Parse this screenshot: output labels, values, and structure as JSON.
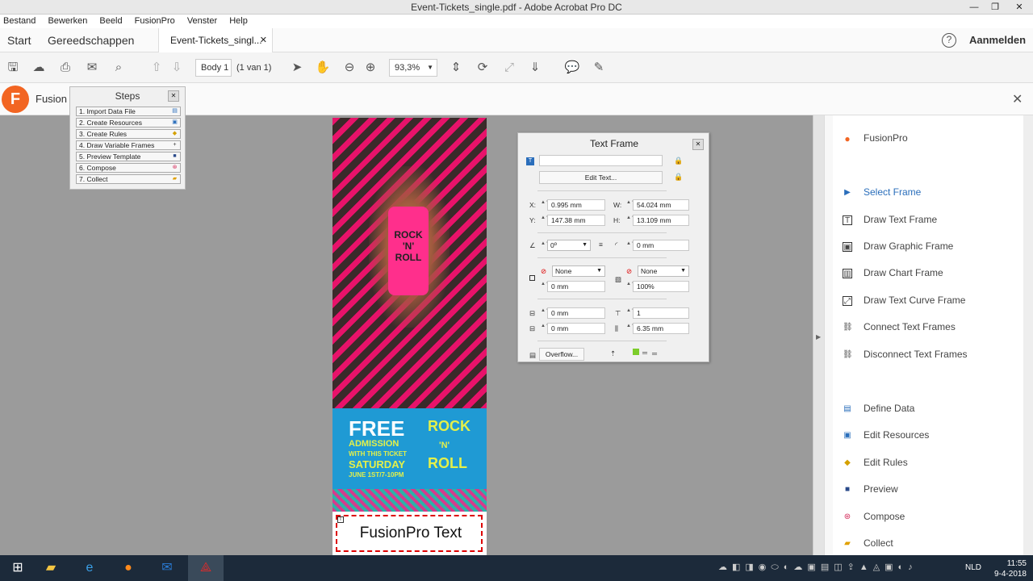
{
  "window": {
    "title": "Event-Tickets_single.pdf - Adobe Acrobat Pro DC"
  },
  "menu": [
    "Bestand",
    "Bewerken",
    "Beeld",
    "FusionPro",
    "Venster",
    "Help"
  ],
  "tabs": {
    "start": "Start",
    "tools": "Gereedschappen",
    "document": "Event-Tickets_singl...",
    "help_icon": "question-icon",
    "signin": "Aanmelden"
  },
  "toolbar": {
    "page_name": "Body 1",
    "page_count": "(1 van 1)",
    "zoom": "93,3%"
  },
  "fusionbar": {
    "title": "Fusion"
  },
  "steps": {
    "title": "Steps",
    "items": [
      "1. Import Data File",
      "2. Create Resources",
      "3. Create Rules",
      "4. Draw Variable Frames",
      "5. Preview Template",
      "6. Compose",
      "7. Collect"
    ]
  },
  "ticket": {
    "hand_text": "ROCK 'N' ROLL",
    "free": "FREE",
    "admission": "ADMISSION",
    "with_ticket": "WITH THIS TICKET",
    "saturday": "SATURDAY",
    "date": "JUNE 1ST/7-10PM",
    "rock": "ROCK",
    "n": "'N'",
    "roll": "ROLL",
    "frame_text": "FusionPro Text"
  },
  "text_frame": {
    "title": "Text Frame",
    "edit_button": "Edit Text...",
    "x_label": "X:",
    "x_value": "0.995 mm",
    "y_label": "Y:",
    "y_value": "147.38 mm",
    "w_label": "W:",
    "w_value": "54.024 mm",
    "h_label": "H:",
    "h_value": "13.109 mm",
    "rotation": "0º",
    "corner": "0 mm",
    "stroke_color": "None",
    "fill_color": "None",
    "stroke_width": "0 mm",
    "tint": "100%",
    "inset_top": "0 mm",
    "inset_bottom": "0 mm",
    "columns": "1",
    "gutter": "6.35 mm",
    "overflow_button": "Overflow..."
  },
  "right_panel": {
    "header": "FusionPro",
    "items": [
      "Select Frame",
      "Draw Text Frame",
      "Draw Graphic Frame",
      "Draw Chart Frame",
      "Draw Text Curve Frame",
      "Connect Text Frames",
      "Disconnect Text Frames",
      "Define Data",
      "Edit Resources",
      "Edit Rules",
      "Preview",
      "Compose",
      "Collect"
    ]
  },
  "taskbar": {
    "lang": "NLD",
    "time": "11:55",
    "date": "9-4-2018"
  },
  "colors": {
    "accent": "#f26522",
    "magenta": "#e8126a",
    "ticket_blue": "#1f9ad4",
    "select_blue": "#2a6ebb"
  }
}
